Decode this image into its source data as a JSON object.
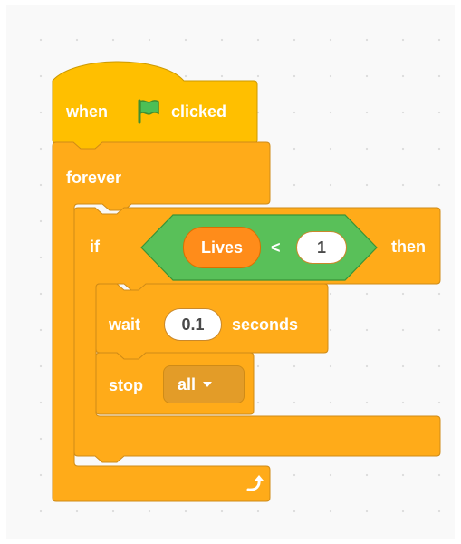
{
  "script": {
    "hat": {
      "when": "when",
      "clicked": "clicked"
    },
    "forever_label": "forever",
    "if_block": {
      "if_label": "if",
      "then_label": "then",
      "condition": {
        "variable": "Lives",
        "operator": "<",
        "value": "1"
      }
    },
    "wait_block": {
      "wait_label": "wait",
      "value": "0.1",
      "seconds_label": "seconds"
    },
    "stop_block": {
      "stop_label": "stop",
      "option": "all"
    }
  },
  "colors": {
    "events": "#ffbf00",
    "control": "#ffab19",
    "control_border": "#cf8b17",
    "operators": "#59c059",
    "variables": "#ff8c1a"
  },
  "icons": [
    "green-flag-icon",
    "loop-arrow-icon",
    "dropdown-caret-icon"
  ]
}
